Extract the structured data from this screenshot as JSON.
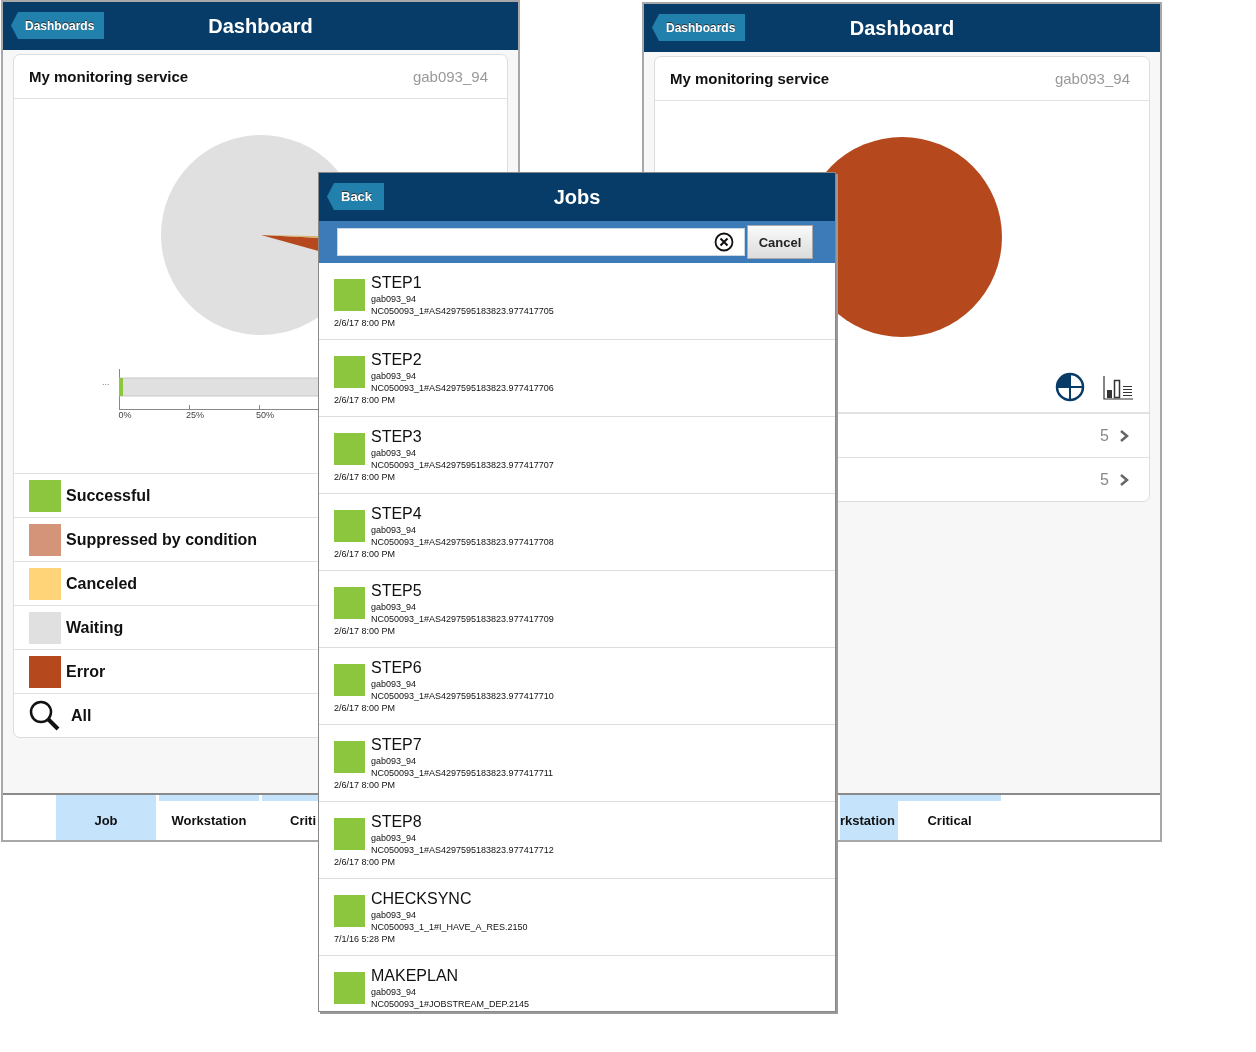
{
  "dashboards": [
    {
      "back_button": "Dashboards",
      "title": "Dashboard",
      "card_title": "My monitoring service",
      "server": "gab093_94",
      "kind": "pie_and_bar",
      "bar_chart": {
        "category_label": "...",
        "ticks": [
          "0%",
          "25%",
          "50%"
        ]
      },
      "legend": [
        {
          "kind": "swatch",
          "label": "Successful",
          "color": "#8cc63f"
        },
        {
          "kind": "swatch",
          "label": "Suppressed by condition",
          "color": "#d3947a"
        },
        {
          "kind": "swatch",
          "label": "Canceled",
          "color": "#ffd479"
        },
        {
          "kind": "swatch",
          "label": "Waiting",
          "color": "#e0e0e0"
        },
        {
          "kind": "swatch",
          "label": "Error",
          "color": "#b5481d"
        },
        {
          "kind": "search",
          "label": "All"
        }
      ],
      "tabs": [
        {
          "label": "Job",
          "selected": true
        },
        {
          "label": "Workstation",
          "selected": false
        },
        {
          "label": "Criti",
          "selected": false
        }
      ]
    },
    {
      "back_button": "Dashboards",
      "title": "Dashboard",
      "card_title": "My monitoring service",
      "server": "gab093_94",
      "kind": "pie_only",
      "count_rows": [
        {
          "count": "5"
        },
        {
          "count": "5"
        }
      ],
      "tabs": [
        {
          "label": "rkstation",
          "selected": true
        },
        {
          "label": "Critical",
          "selected": false
        }
      ]
    }
  ],
  "jobs_window": {
    "back_button": "Back",
    "title": "Jobs",
    "cancel_button": "Cancel",
    "jobs": [
      {
        "name": "STEP1",
        "server": "gab093_94",
        "job_id": "NC050093_1#AS4297595183823.977417705",
        "time": "2/6/17 8:00 PM",
        "color": "#8cc63f"
      },
      {
        "name": "STEP2",
        "server": "gab093_94",
        "job_id": "NC050093_1#AS4297595183823.977417706",
        "time": "2/6/17 8:00 PM",
        "color": "#8cc63f"
      },
      {
        "name": "STEP3",
        "server": "gab093_94",
        "job_id": "NC050093_1#AS4297595183823.977417707",
        "time": "2/6/17 8:00 PM",
        "color": "#8cc63f"
      },
      {
        "name": "STEP4",
        "server": "gab093_94",
        "job_id": "NC050093_1#AS4297595183823.977417708",
        "time": "2/6/17 8:00 PM",
        "color": "#8cc63f"
      },
      {
        "name": "STEP5",
        "server": "gab093_94",
        "job_id": "NC050093_1#AS4297595183823.977417709",
        "time": "2/6/17 8:00 PM",
        "color": "#8cc63f"
      },
      {
        "name": "STEP6",
        "server": "gab093_94",
        "job_id": "NC050093_1#AS4297595183823.977417710",
        "time": "2/6/17 8:00 PM",
        "color": "#8cc63f"
      },
      {
        "name": "STEP7",
        "server": "gab093_94",
        "job_id": "NC050093_1#AS4297595183823.977417711",
        "time": "2/6/17 8:00 PM",
        "color": "#8cc63f"
      },
      {
        "name": "STEP8",
        "server": "gab093_94",
        "job_id": "NC050093_1#AS4297595183823.977417712",
        "time": "2/6/17 8:00 PM",
        "color": "#8cc63f"
      },
      {
        "name": "CHECKSYNC",
        "server": "gab093_94",
        "job_id": "NC050093_1_1#I_HAVE_A_RES.2150",
        "time": "7/1/16 5:28 PM",
        "color": "#8cc63f"
      },
      {
        "name": "MAKEPLAN",
        "server": "gab093_94",
        "job_id": "NC050093_1#JOBSTREAM_DEP.2145",
        "color": "#8cc63f"
      }
    ]
  }
}
